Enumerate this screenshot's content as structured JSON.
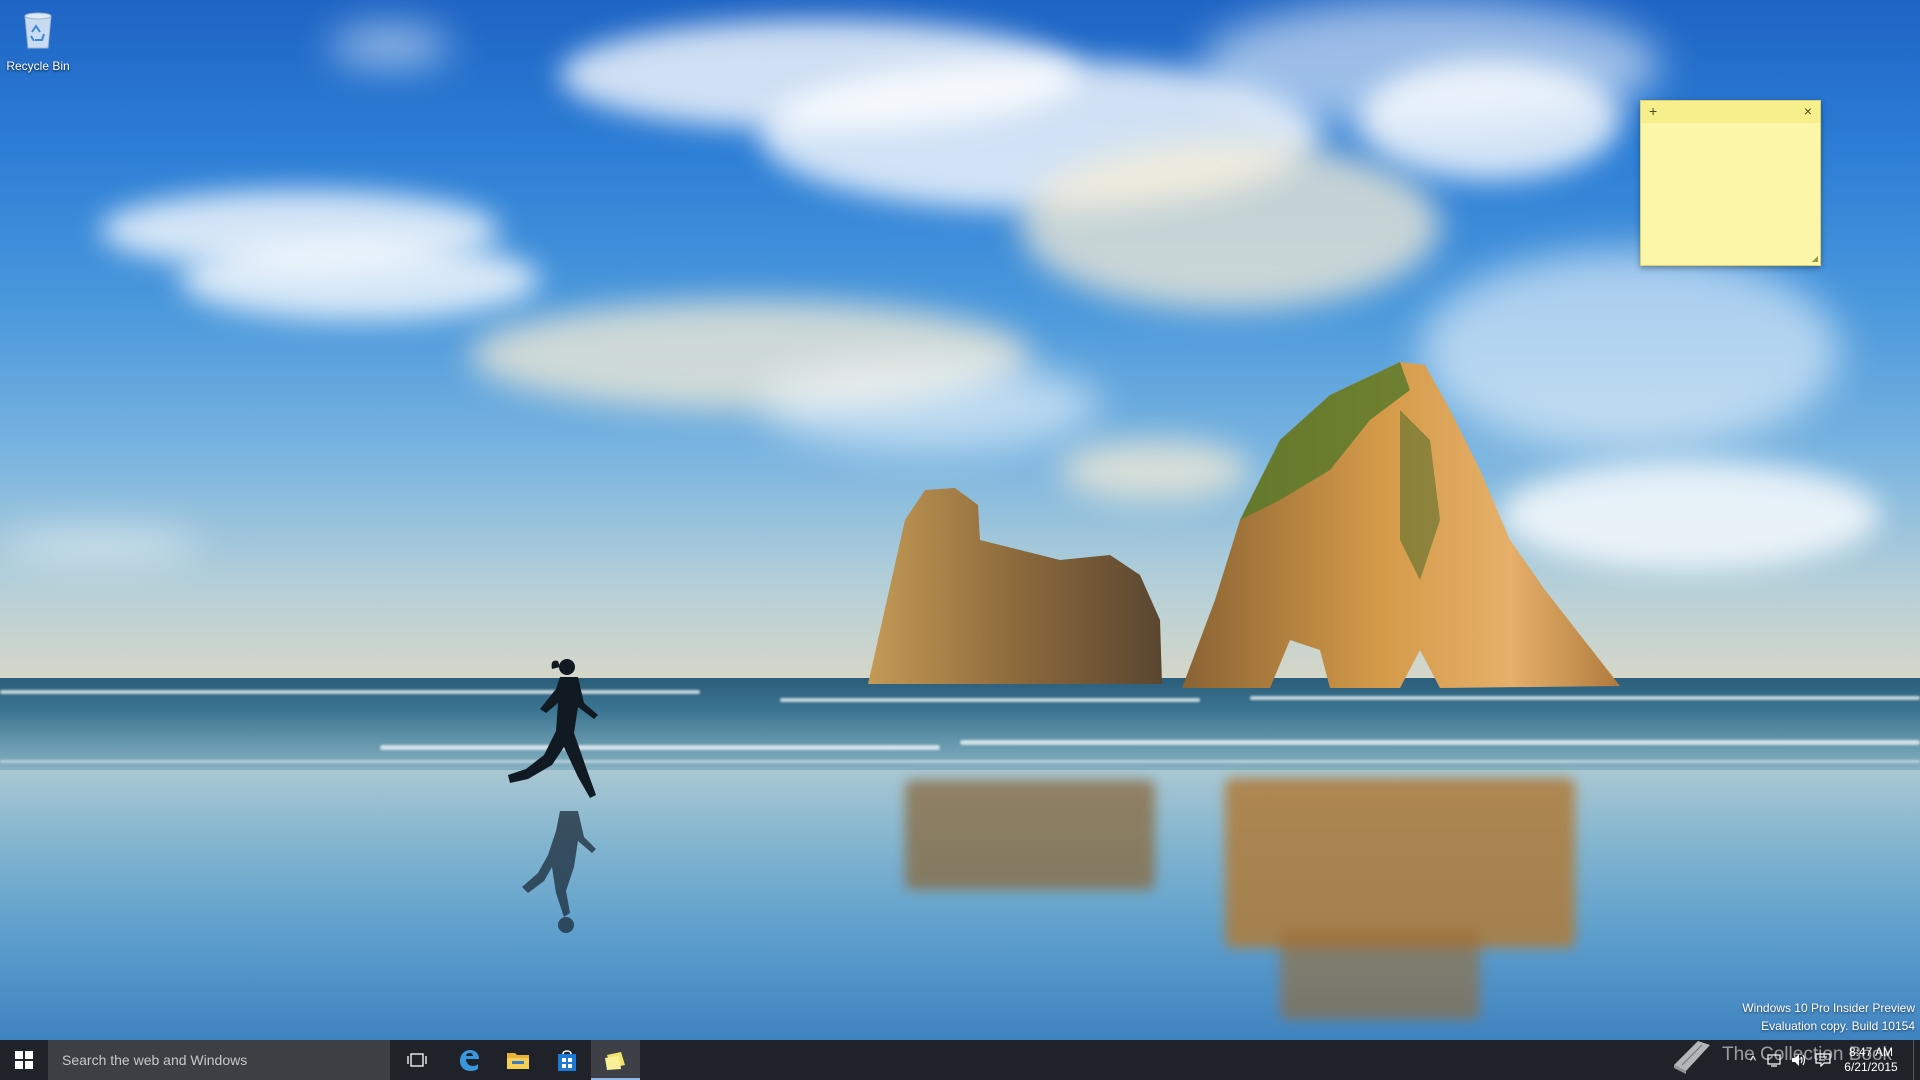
{
  "desktop": {
    "icons": [
      {
        "label": "Recycle Bin",
        "icon": "recycle-bin-icon"
      }
    ],
    "wallpaper": "beach-runner-rock-arches"
  },
  "sticky_note": {
    "add_icon": "+",
    "close_icon": "×",
    "text": ""
  },
  "watermark": {
    "line1": "Windows 10 Pro Insider Preview",
    "line2": "Evaluation copy. Build 10154"
  },
  "taskbar": {
    "start_icon": "windows-logo-icon",
    "search_placeholder": "Search the web and Windows",
    "pinned": [
      {
        "name": "task-view",
        "icon": "task-view-icon"
      },
      {
        "name": "edge",
        "icon": "edge-browser-icon"
      },
      {
        "name": "file-explorer",
        "icon": "folder-icon"
      },
      {
        "name": "store",
        "icon": "store-icon"
      },
      {
        "name": "sticky-notes",
        "icon": "sticky-notes-icon",
        "active": true
      }
    ],
    "tray": {
      "chevron": "^",
      "icons": [
        "network-icon",
        "volume-icon",
        "action-center-icon"
      ],
      "time": "8:47 AM",
      "date": "6/21/2015"
    },
    "branding": "The Collection Book"
  },
  "colors": {
    "taskbar_bg": "#1f2329",
    "search_bg": "#3c3f43",
    "sticky_bg": "#fcf7a8",
    "active_underline": "#8fb8e6"
  }
}
